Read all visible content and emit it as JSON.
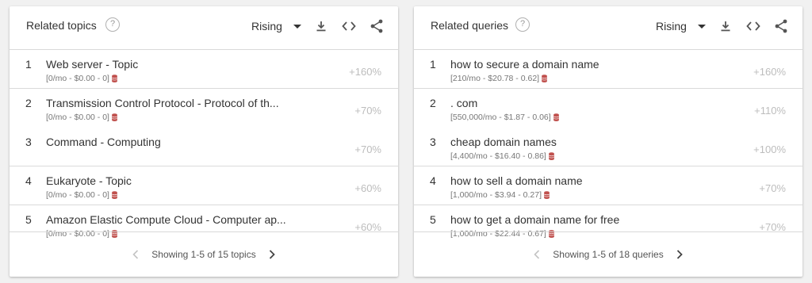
{
  "icons": {
    "help": "help-circle-icon",
    "dropdown": "caret-down-icon",
    "download": "download-icon",
    "embed": "code-embed-icon",
    "share": "share-icon",
    "db": "database-icon",
    "prev": "chevron-left-icon",
    "next": "chevron-right-icon"
  },
  "colors": {
    "value_gray": "#bdbdbd",
    "db_icon_red": "#c0504d"
  },
  "topics": {
    "title": "Related topics",
    "help_glyph": "?",
    "filter": "Rising",
    "rows": [
      {
        "rank": "1",
        "title": "Web server - Topic",
        "meta": "[0/mo - $0.00 - 0]",
        "value": "+160%"
      },
      {
        "rank": "2",
        "title": "Transmission Control Protocol - Protocol of th...",
        "meta": "[0/mo - $0.00 - 0]",
        "value": "+70%"
      },
      {
        "rank": "3",
        "title": "Command - Computing",
        "meta": "",
        "value": "+70%"
      },
      {
        "rank": "4",
        "title": "Eukaryote - Topic",
        "meta": "[0/mo - $0.00 - 0]",
        "value": "+60%"
      },
      {
        "rank": "5",
        "title": "Amazon Elastic Compute Cloud - Computer ap...",
        "meta": "[0/mo - $0.00 - 0]",
        "value": "+60%"
      }
    ],
    "pager_text": "Showing 1-5 of 15 topics"
  },
  "queries": {
    "title": "Related queries",
    "help_glyph": "?",
    "filter": "Rising",
    "rows": [
      {
        "rank": "1",
        "title": "how to secure a domain name",
        "meta": "[210/mo - $20.78 - 0.62]",
        "value": "+160%"
      },
      {
        "rank": "2",
        "title": ". com",
        "meta": "[550,000/mo - $1.87 - 0.06]",
        "value": "+110%"
      },
      {
        "rank": "3",
        "title": "cheap domain names",
        "meta": "[4,400/mo - $16.40 - 0.86]",
        "value": "+100%"
      },
      {
        "rank": "4",
        "title": "how to sell a domain name",
        "meta": "[1,000/mo - $3.94 - 0.27]",
        "value": "+70%"
      },
      {
        "rank": "5",
        "title": "how to get a domain name for free",
        "meta": "[1,000/mo - $22.44 - 0.67]",
        "value": "+70%"
      }
    ],
    "pager_text": "Showing 1-5 of 18 queries"
  }
}
